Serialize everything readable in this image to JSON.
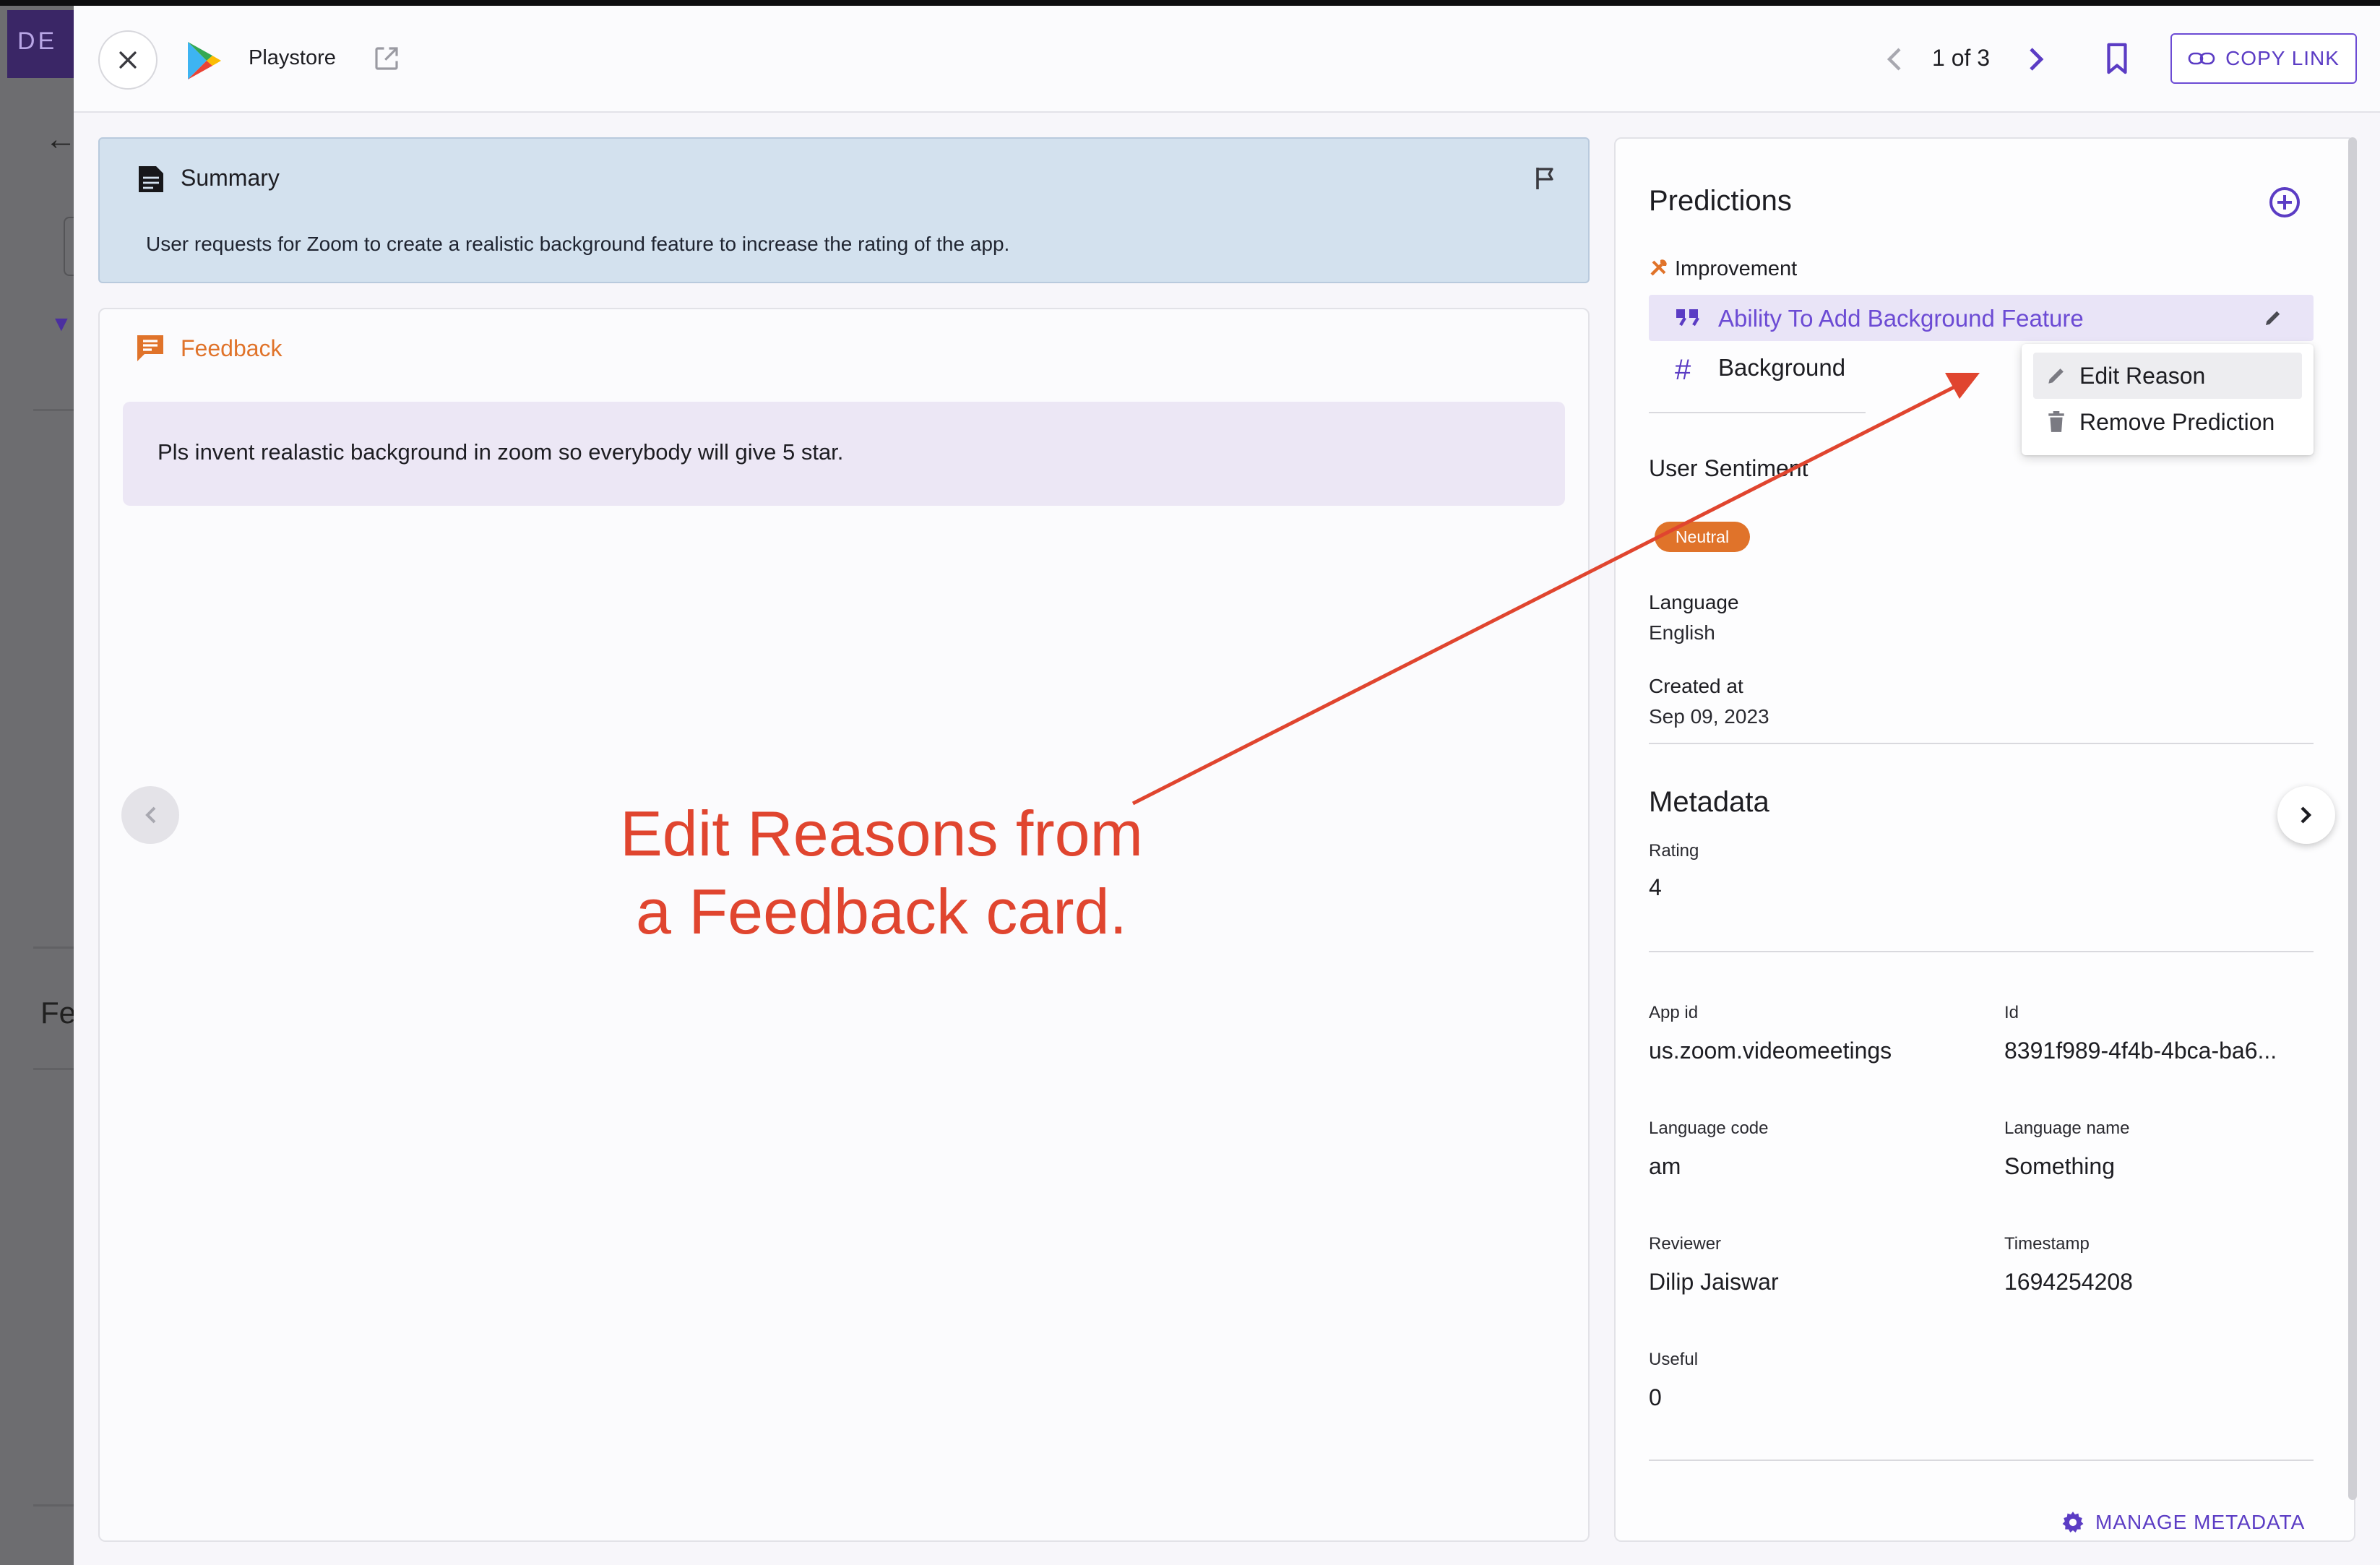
{
  "background_app": {
    "brand_text": "DE",
    "section_label": "Fe"
  },
  "header": {
    "source_name": "Playstore",
    "pager": "1 of 3",
    "copy_link_label": "COPY LINK"
  },
  "summary": {
    "title": "Summary",
    "text": "User requests for Zoom to create a realistic background feature to increase the rating of the app."
  },
  "feedback": {
    "title": "Feedback",
    "text": "Pls invent realastic background in zoom so everybody will give 5 star."
  },
  "annotation": {
    "line1": "Edit Reasons from",
    "line2": "a Feedback card.",
    "color": "#e0452f"
  },
  "predictions": {
    "title": "Predictions",
    "category": "Improvement",
    "reason": "Ability To Add Background Feature",
    "keyword": "Background",
    "menu": {
      "edit": "Edit Reason",
      "remove": "Remove Prediction"
    }
  },
  "details": {
    "sentiment_label": "User Sentiment",
    "sentiment_value": "Neutral",
    "language_label": "Language",
    "language_value": "English",
    "created_label": "Created at",
    "created_value": "Sep 09, 2023"
  },
  "metadata": {
    "title": "Metadata",
    "rating_label": "Rating",
    "rating_value": "4",
    "fields": [
      {
        "label": "App id",
        "value": "us.zoom.videomeetings"
      },
      {
        "label": "Id",
        "value": "8391f989-4f4b-4bca-ba6..."
      },
      {
        "label": "Language code",
        "value": "am"
      },
      {
        "label": "Language name",
        "value": "Something"
      },
      {
        "label": "Reviewer",
        "value": "Dilip Jaiswar"
      },
      {
        "label": "Timestamp",
        "value": "1694254208"
      },
      {
        "label": "Useful",
        "value": "0"
      }
    ],
    "manage_label": "MANAGE METADATA"
  },
  "colors": {
    "accent": "#6c4bd4",
    "orange": "#e0732a",
    "summary_bg": "#d3e1ee"
  }
}
